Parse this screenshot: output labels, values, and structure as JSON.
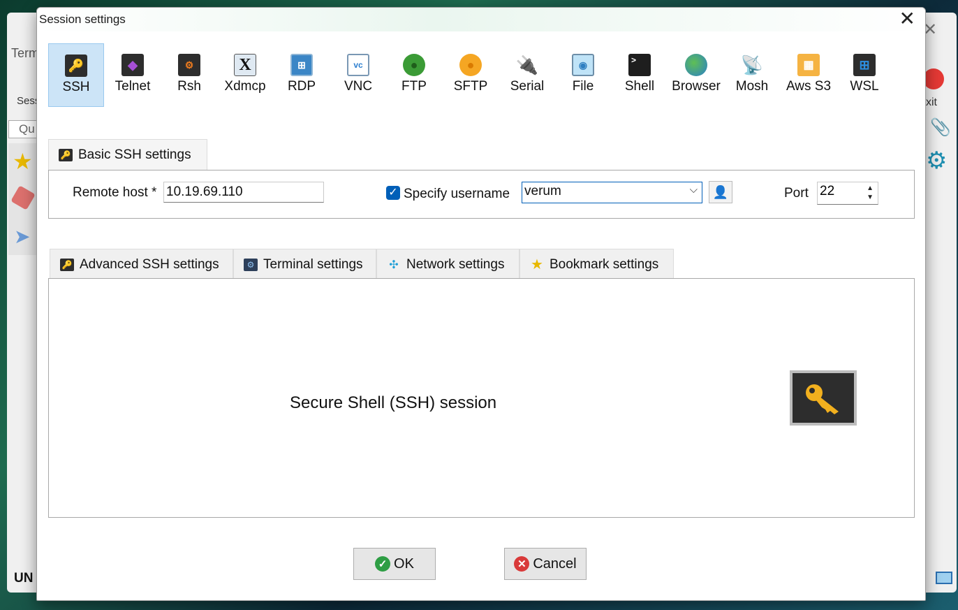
{
  "background_window": {
    "partial_tab": "Term",
    "partial_session": "Sess",
    "partial_quick": "Qu",
    "partial_status": "UN",
    "partial_exit": "xit"
  },
  "dialog": {
    "title": "Session settings",
    "session_types": [
      {
        "label": "SSH",
        "icon": "key-icon",
        "selected": true
      },
      {
        "label": "Telnet",
        "icon": "telnet-icon"
      },
      {
        "label": "Rsh",
        "icon": "rsh-icon"
      },
      {
        "label": "Xdmcp",
        "icon": "x-icon"
      },
      {
        "label": "RDP",
        "icon": "rdp-icon"
      },
      {
        "label": "VNC",
        "icon": "vnc-icon"
      },
      {
        "label": "FTP",
        "icon": "globe-icon"
      },
      {
        "label": "SFTP",
        "icon": "globe-icon"
      },
      {
        "label": "Serial",
        "icon": "serial-plug-icon"
      },
      {
        "label": "File",
        "icon": "monitor-icon"
      },
      {
        "label": "Shell",
        "icon": "terminal-icon"
      },
      {
        "label": "Browser",
        "icon": "earth-icon"
      },
      {
        "label": "Mosh",
        "icon": "satellite-icon"
      },
      {
        "label": "Aws S3",
        "icon": "aws-boxes-icon"
      },
      {
        "label": "WSL",
        "icon": "windows-icon"
      }
    ],
    "basic_tab": {
      "label": "Basic SSH settings"
    },
    "remote_host": {
      "label": "Remote host *",
      "value": "10.19.69.110"
    },
    "specify_username": {
      "label": "Specify username",
      "checked": true,
      "value": "verum"
    },
    "port": {
      "label": "Port",
      "value": "22"
    },
    "advanced_tabs": [
      {
        "label": "Advanced SSH settings"
      },
      {
        "label": "Terminal settings"
      },
      {
        "label": "Network settings"
      },
      {
        "label": "Bookmark settings"
      }
    ],
    "description": "Secure Shell (SSH) session",
    "ok_label": "OK",
    "cancel_label": "Cancel"
  },
  "colors": {
    "selected_bg": "#cce4f7",
    "accent": "#005fb8",
    "ok_green": "#2e9e44",
    "cancel_red": "#d93a3a",
    "key_gold": "#f2b01e"
  }
}
